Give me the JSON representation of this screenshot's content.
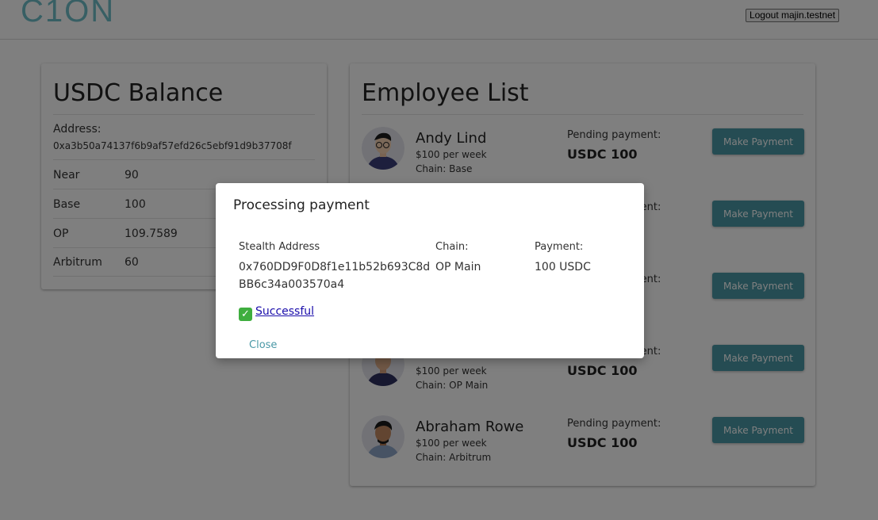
{
  "header": {
    "logo": "C1ON",
    "logout_label": "Logout majin.testnet"
  },
  "balance": {
    "title": "USDC Balance",
    "address_label": "Address:",
    "address": "0xa3b50a74137f6b9af57efd26c5ebf91d9b37708f",
    "rows": [
      {
        "name": "Near",
        "value": "90"
      },
      {
        "name": "Base",
        "value": "100"
      },
      {
        "name": "OP",
        "value": "109.7589"
      },
      {
        "name": "Arbitrum",
        "value": "60"
      }
    ]
  },
  "employees": {
    "title": "Employee List",
    "pending_label": "Pending payment:",
    "button_label": "Make Payment",
    "items": [
      {
        "name": "Andy Lind",
        "rate": "$100 per week",
        "chain": "Chain: Base",
        "pending": "USDC 100"
      },
      {
        "name": "",
        "rate": "",
        "chain": "",
        "pending": ""
      },
      {
        "name": "",
        "rate": "",
        "chain": "",
        "pending": ""
      },
      {
        "name": "",
        "rate": "$100 per week",
        "chain": "Chain: OP Main",
        "pending": "USDC 100"
      },
      {
        "name": "Abraham Rowe",
        "rate": "$100 per week",
        "chain": "Chain: Arbitrum",
        "pending": "USDC 100"
      }
    ]
  },
  "modal": {
    "title": "Processing payment",
    "stealth_label": "Stealth Address",
    "stealth_line1": "0x760DD9F0D8f1e11b52b693C8d",
    "stealth_line2": "BB6c34a003570a4",
    "chain_label": "Chain:",
    "chain_value": "OP Main",
    "payment_label": "Payment:",
    "payment_value": "100 USDC",
    "success_text": "Successful",
    "close_label": "Close"
  },
  "colors": {
    "accent": "#4a98a6",
    "logo": "#6fbfc8",
    "overlay": "rgba(0,0,0,0.5)",
    "success": "#3fae3f"
  }
}
